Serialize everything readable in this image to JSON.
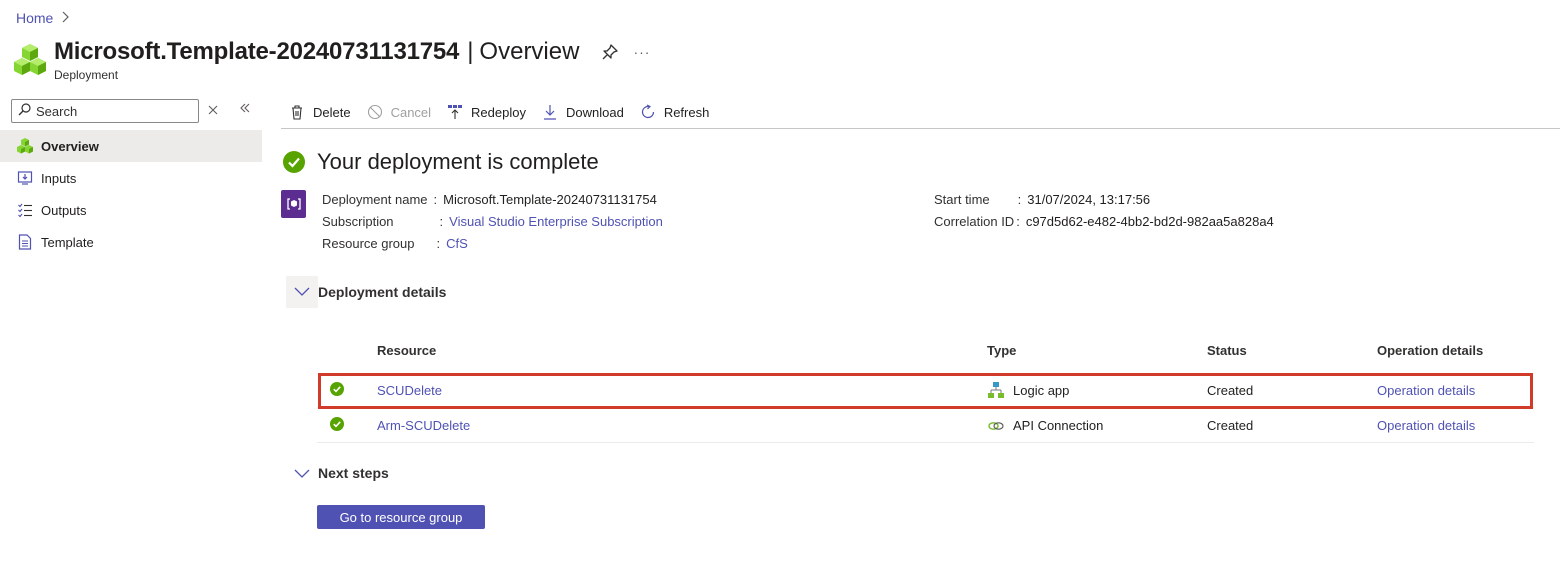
{
  "breadcrumb": {
    "home": "Home"
  },
  "header": {
    "title": "Microsoft.Template-20240731131754",
    "separator": "|",
    "section": "Overview",
    "subtitle": "Deployment",
    "more": "···"
  },
  "sidebar": {
    "search_placeholder": "Search",
    "items": [
      {
        "label": "Overview",
        "icon": "deployment-cubes-icon",
        "active": true
      },
      {
        "label": "Inputs",
        "icon": "inputs-icon"
      },
      {
        "label": "Outputs",
        "icon": "outputs-icon"
      },
      {
        "label": "Template",
        "icon": "template-document-icon"
      }
    ]
  },
  "toolbar": {
    "delete": "Delete",
    "cancel": "Cancel",
    "redeploy": "Redeploy",
    "download": "Download",
    "refresh": "Refresh"
  },
  "status": {
    "title": "Your deployment is complete"
  },
  "essentials": {
    "deployment_name_label": "Deployment name",
    "deployment_name": "Microsoft.Template-20240731131754",
    "subscription_label": "Subscription",
    "subscription": "Visual Studio Enterprise Subscription",
    "resource_group_label": "Resource group",
    "resource_group": "CfS",
    "start_time_label": "Start time",
    "start_time": "31/07/2024, 13:17:56",
    "correlation_label": "Correlation ID",
    "correlation_id": "c97d5d62-e482-4bb2-bd2d-982aa5a828a4",
    "colon": ":"
  },
  "details": {
    "label": "Deployment details",
    "columns": [
      "Resource",
      "Type",
      "Status",
      "Operation details"
    ],
    "rows": [
      {
        "resource": "SCUDelete",
        "type": "Logic app",
        "type_icon": "logic-app-icon",
        "status": "Created",
        "operation": "Operation details",
        "highlighted": true
      },
      {
        "resource": "Arm-SCUDelete",
        "type": "API Connection",
        "type_icon": "api-connection-icon",
        "status": "Created",
        "operation": "Operation details",
        "highlighted": false
      }
    ]
  },
  "next_steps": {
    "label": "Next steps",
    "button": "Go to resource group"
  },
  "colors": {
    "accent": "#4f52b2",
    "success": "#57a300",
    "highlight_border": "#d13b2a",
    "deployment_icon_bg": "#5c2d91"
  }
}
